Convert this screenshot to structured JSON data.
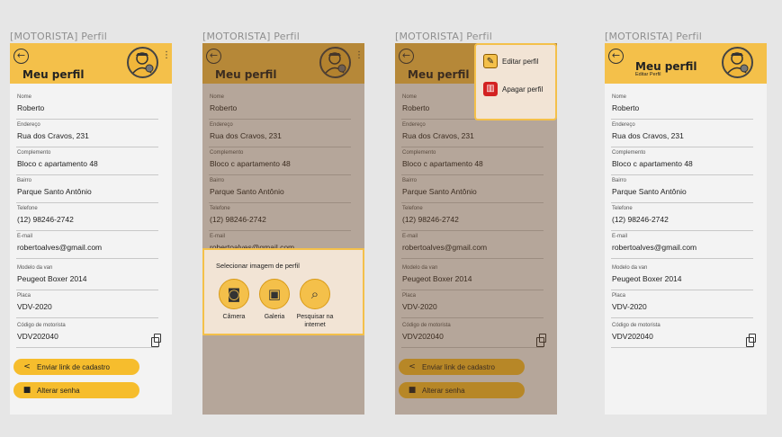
{
  "colors": {
    "accent": "#f4c04a",
    "button": "#f6bd2d",
    "background": "#f3f3f3",
    "overlay": "rgba(95,60,30,0.42)"
  },
  "screens": [
    {
      "label": "[MOTORISTA] Perfil"
    },
    {
      "label": "[MOTORISTA] Perfil"
    },
    {
      "label": "[MOTORISTA] Perfil"
    },
    {
      "label": "[MOTORISTA] Perfil"
    }
  ],
  "profile": {
    "title": "Meu perfil",
    "subtitle": "Editar Perfil",
    "fields": [
      {
        "label": "Nome",
        "value": "Roberto"
      },
      {
        "label": "Endereço",
        "value": "Rua dos Cravos, 231"
      },
      {
        "label": "Complemento",
        "value": "Bloco c apartamento 48"
      },
      {
        "label": "Bairro",
        "value": "Parque Santo Antônio"
      },
      {
        "label": "Telefone",
        "value": "(12) 98246-2742"
      },
      {
        "label": "E-mail",
        "value": "robertoalves@gmail.com"
      },
      {
        "label": "Modelo da van",
        "value": "Peugeot Boxer 2014"
      },
      {
        "label": "Placa",
        "value": "VDV-2020"
      },
      {
        "label": "Código de motorista",
        "value": "VDV202040"
      }
    ],
    "actions": [
      {
        "label": "Enviar link de cadastro",
        "icon": "share-icon"
      },
      {
        "label": "Alterar senha",
        "icon": "lock-icon"
      }
    ]
  },
  "image_sheet": {
    "title": "Selecionar imagem de perfil",
    "options": [
      {
        "label": "Câmera",
        "icon": "camera-icon"
      },
      {
        "label": "Galeria",
        "icon": "gallery-icon"
      },
      {
        "label": "Pesquisar na internet",
        "icon": "web-search-icon"
      }
    ]
  },
  "menu": {
    "items": [
      {
        "label": "Editar perfil",
        "icon": "edit-folder-icon"
      },
      {
        "label": "Apagar perfil",
        "icon": "trash-icon"
      }
    ]
  }
}
